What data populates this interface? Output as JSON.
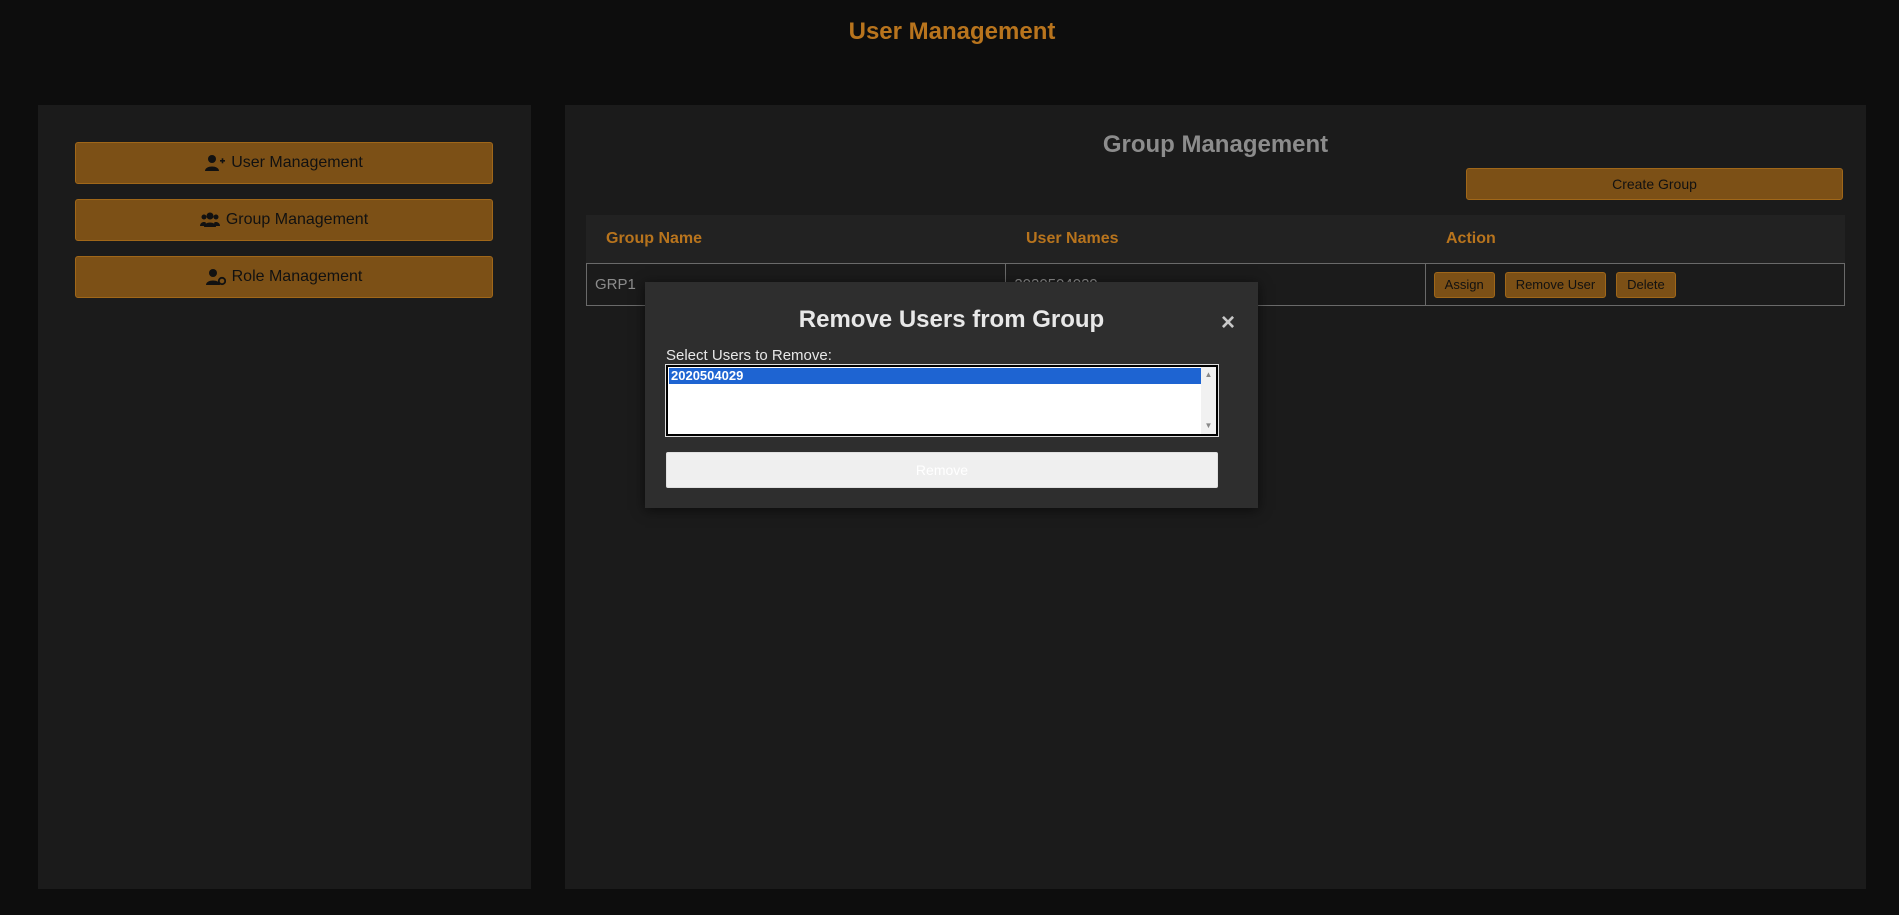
{
  "app": {
    "title": "User Management"
  },
  "sidebar": {
    "items": [
      {
        "label": "User Management",
        "icon": "user-plus-icon"
      },
      {
        "label": "Group Management",
        "icon": "users-icon"
      },
      {
        "label": "Role Management",
        "icon": "user-gear-icon"
      }
    ]
  },
  "main": {
    "title": "Group Management",
    "create_label": "Create Group",
    "table": {
      "headers": [
        "Group Name",
        "User Names",
        "Action"
      ],
      "rows": [
        {
          "group_name": "GRP1",
          "user_names": "2020504029",
          "actions": [
            "Assign",
            "Remove User",
            "Delete"
          ]
        }
      ]
    }
  },
  "modal": {
    "title": "Remove Users from Group",
    "close_label": "×",
    "select_label": "Select Users to Remove:",
    "options": [
      "2020504029"
    ],
    "selected": "2020504029",
    "submit_label": "Remove"
  },
  "colors": {
    "accent": "#b8741d",
    "button_bg": "#7c5016",
    "background": "#0d0d0d",
    "panel": "#1b1b1b",
    "modal": "#2e2e2e",
    "selection": "#1e64d2"
  }
}
